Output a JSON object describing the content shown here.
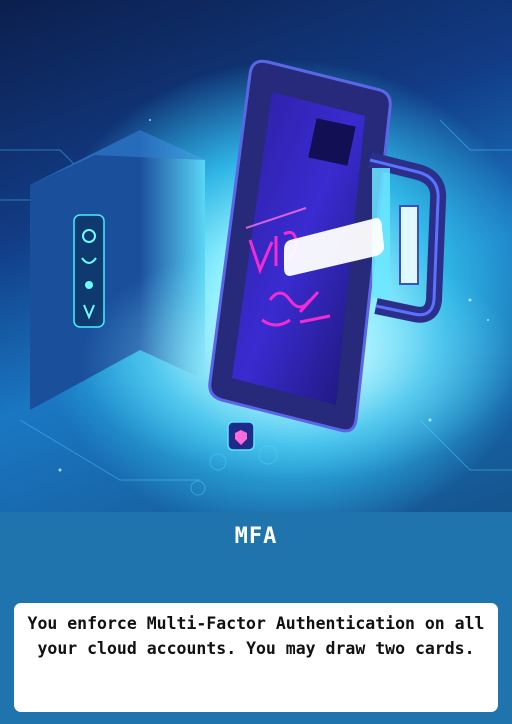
{
  "card": {
    "title": "MFA",
    "description": "You enforce Multi-Factor Authentication on all your cloud accounts. You may draw two cards."
  },
  "illustration": {
    "subject": "phone-with-padlock",
    "colors": {
      "neon_pink": "#ff2bd6",
      "cyan": "#38e8ff",
      "deep_blue": "#1a2a8c"
    }
  },
  "colors": {
    "panel": "#1f74ad",
    "text_box": "#ffffff",
    "title": "#ffffff",
    "body_text": "#111111"
  }
}
